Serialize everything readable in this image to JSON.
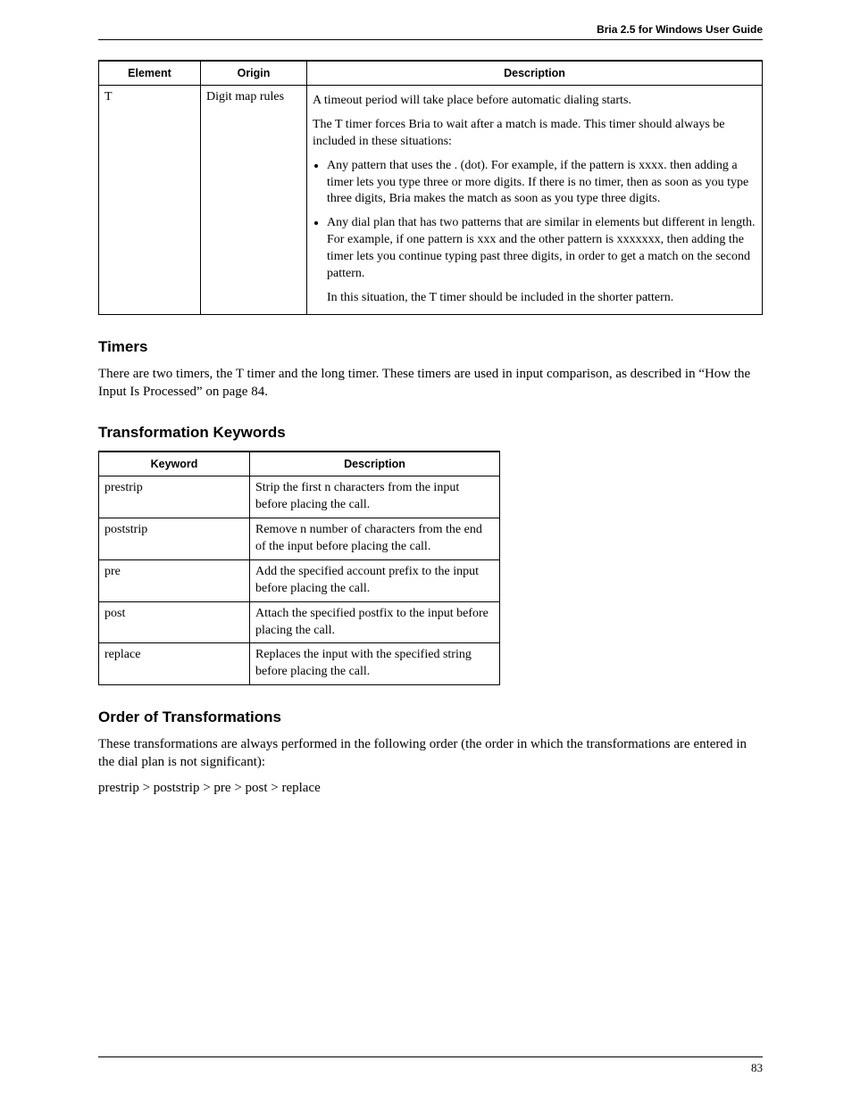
{
  "header": {
    "title": "Bria 2.5 for Windows User Guide"
  },
  "table1": {
    "headers": [
      "Element",
      "Origin",
      "Description"
    ],
    "row": {
      "element": "T",
      "origin": "Digit map rules",
      "p1": "A timeout period will take place before automatic dialing starts.",
      "p2": "The T timer forces Bria to wait after a match is made. This timer should always be included in these situations:",
      "b1": "Any pattern that uses the . (dot). For example, if the pattern is xxxx. then adding a timer lets you type three or more digits. If there is no timer, then as soon as you type three digits, Bria makes the match as soon as you type three digits.",
      "b2": "Any dial plan that has two patterns that are similar in elements but different in length. For example, if one pattern is xxx and the other pattern is xxxxxxx, then adding the timer lets you continue typing past three digits, in order to get a match on the second pattern.",
      "note": "In this situation, the T timer should be included in the shorter pattern."
    }
  },
  "timers": {
    "heading": "Timers",
    "body": "There are two timers, the T timer and the long timer. These timers are used in input comparison, as described in “How the Input Is Processed” on page 84."
  },
  "transform": {
    "heading": "Transformation Keywords",
    "headers": [
      "Keyword",
      "Description"
    ],
    "rows": [
      {
        "k": "prestrip",
        "d": "Strip the first n characters from the input before placing the call."
      },
      {
        "k": "poststrip",
        "d": "Remove n number of characters from the end of the input before placing the call."
      },
      {
        "k": "pre",
        "d": "Add the specified account prefix to the input before placing the call."
      },
      {
        "k": "post",
        "d": "Attach the specified postfix to the input before placing the call."
      },
      {
        "k": "replace",
        "d": "Replaces the input with the specified string before placing the call."
      }
    ]
  },
  "order": {
    "heading": "Order of Transformations",
    "body": "These transformations are always performed in the following order (the order in which the transformations are entered in the dial plan is not significant):",
    "seq": "prestrip  >  poststrip  >  pre >  post  >  replace"
  },
  "footer": {
    "page": "83"
  }
}
